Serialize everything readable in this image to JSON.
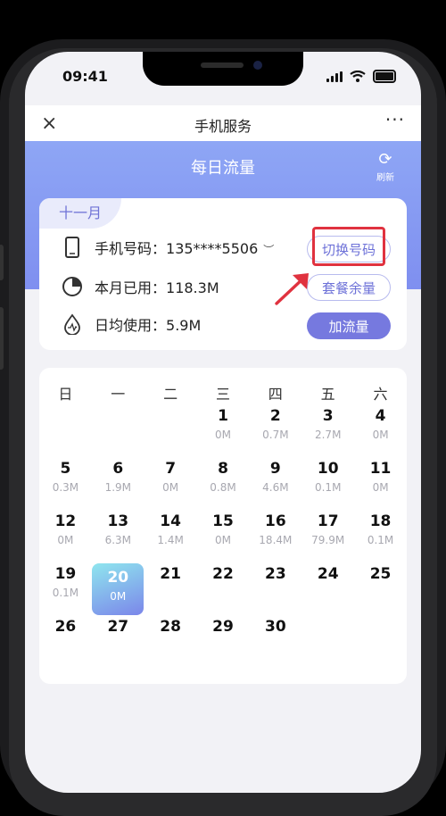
{
  "status_bar": {
    "time": "09:41"
  },
  "navbar": {
    "close": "×",
    "title": "手机服务",
    "more": "···"
  },
  "banner": {
    "title": "每日流量",
    "refresh_label": "刷新"
  },
  "info": {
    "month": "十一月",
    "phone_label": "手机号码：",
    "phone_value": "135****5506",
    "used_label": "本月已用：",
    "used_value": "118.3M",
    "avg_label": "日均使用：",
    "avg_value": "5.9M",
    "switch_button": "切换号码",
    "plan_button": "套餐余量",
    "add_button": "加流量"
  },
  "calendar": {
    "weekdays": [
      "日",
      "一",
      "二",
      "三",
      "四",
      "五",
      "六"
    ],
    "days": [
      {
        "d": "1",
        "u": "0M",
        "c": 3,
        "r": 0
      },
      {
        "d": "2",
        "u": "0.7M",
        "c": 4,
        "r": 0
      },
      {
        "d": "3",
        "u": "2.7M",
        "c": 5,
        "r": 0
      },
      {
        "d": "4",
        "u": "0M",
        "c": 6,
        "r": 0
      },
      {
        "d": "5",
        "u": "0.3M",
        "c": 0,
        "r": 1
      },
      {
        "d": "6",
        "u": "1.9M",
        "c": 1,
        "r": 1
      },
      {
        "d": "7",
        "u": "0M",
        "c": 2,
        "r": 1
      },
      {
        "d": "8",
        "u": "0.8M",
        "c": 3,
        "r": 1
      },
      {
        "d": "9",
        "u": "4.6M",
        "c": 4,
        "r": 1
      },
      {
        "d": "10",
        "u": "0.1M",
        "c": 5,
        "r": 1
      },
      {
        "d": "11",
        "u": "0M",
        "c": 6,
        "r": 1
      },
      {
        "d": "12",
        "u": "0M",
        "c": 0,
        "r": 2
      },
      {
        "d": "13",
        "u": "6.3M",
        "c": 1,
        "r": 2
      },
      {
        "d": "14",
        "u": "1.4M",
        "c": 2,
        "r": 2
      },
      {
        "d": "15",
        "u": "0M",
        "c": 3,
        "r": 2
      },
      {
        "d": "16",
        "u": "18.4M",
        "c": 4,
        "r": 2
      },
      {
        "d": "17",
        "u": "79.9M",
        "c": 5,
        "r": 2
      },
      {
        "d": "18",
        "u": "0.1M",
        "c": 6,
        "r": 2
      },
      {
        "d": "19",
        "u": "0.1M",
        "c": 0,
        "r": 3
      },
      {
        "d": "20",
        "u": "0M",
        "c": 1,
        "r": 3,
        "selected": true
      },
      {
        "d": "21",
        "u": "",
        "c": 2,
        "r": 3
      },
      {
        "d": "22",
        "u": "",
        "c": 3,
        "r": 3
      },
      {
        "d": "23",
        "u": "",
        "c": 4,
        "r": 3
      },
      {
        "d": "24",
        "u": "",
        "c": 5,
        "r": 3
      },
      {
        "d": "25",
        "u": "",
        "c": 6,
        "r": 3
      },
      {
        "d": "26",
        "u": "",
        "c": 0,
        "r": 4
      },
      {
        "d": "27",
        "u": "",
        "c": 1,
        "r": 4
      },
      {
        "d": "28",
        "u": "",
        "c": 2,
        "r": 4
      },
      {
        "d": "29",
        "u": "",
        "c": 3,
        "r": 4
      },
      {
        "d": "30",
        "u": "",
        "c": 4,
        "r": 4
      }
    ]
  },
  "colors": {
    "accent": "#7679df",
    "banner": "#8ea6f5",
    "highlight": "#e0323f"
  }
}
